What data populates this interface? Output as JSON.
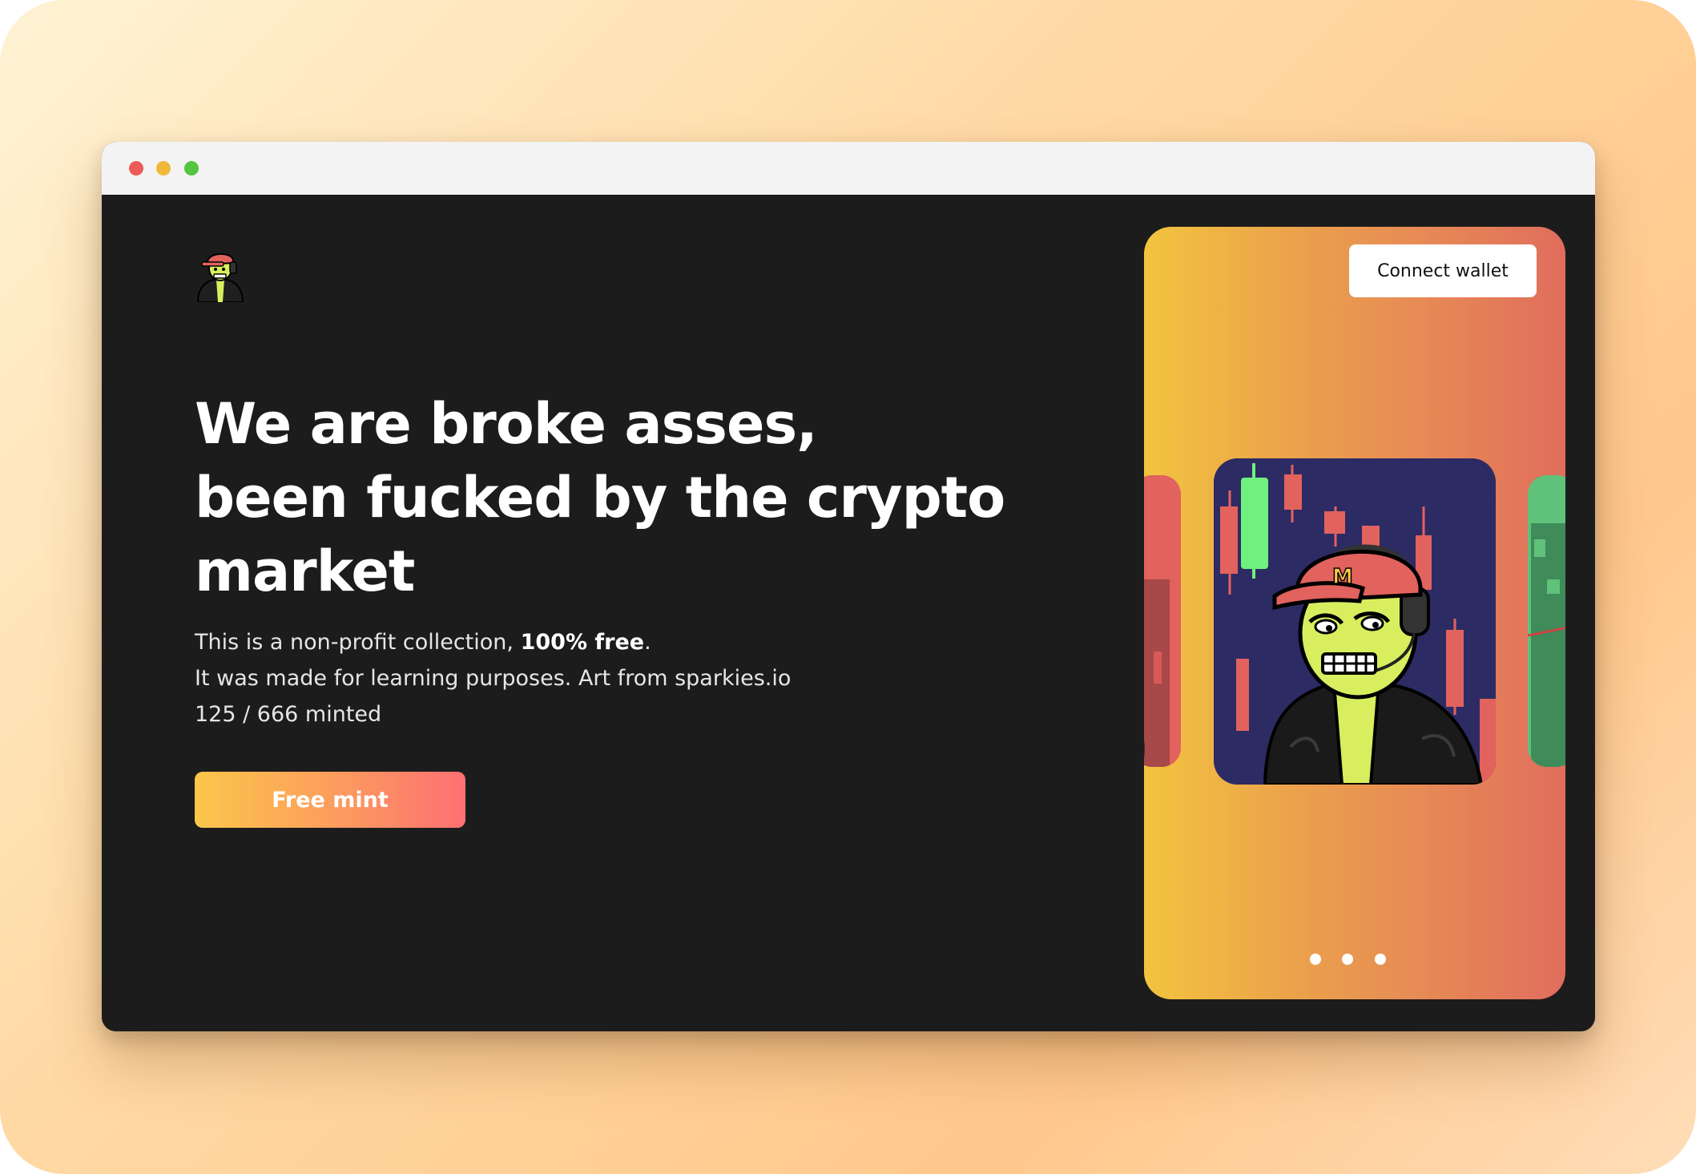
{
  "hero": {
    "headline_lines": [
      "We are broke asses,",
      "been fucked by the crypto",
      "market"
    ],
    "description_line1_prefix": "This is a non-profit collection, ",
    "description_line1_bold": "100% free",
    "description_line1_suffix": ".",
    "description_line2": "It was made for learning purposes. Art from sparkies.io",
    "minted_status": "125 / 666 minted",
    "minted_count": 125,
    "minted_total": 666,
    "mint_button_label": "Free mint"
  },
  "header": {
    "connect_wallet_label": "Connect wallet",
    "logo_icon": "character-avatar-icon"
  },
  "carousel": {
    "slide_count": 3,
    "active_slide": 2,
    "slides": [
      "red-card",
      "character-card",
      "green-card"
    ]
  },
  "colors": {
    "page_background": "#1c1c1c",
    "accent_start": "#fbc64a",
    "accent_end": "#fd6f73",
    "panel_start": "#f2c43e",
    "panel_end": "#e06d5d",
    "titlebar_red": "#ec5b57",
    "titlebar_yellow": "#f0b83a",
    "titlebar_green": "#55c43f"
  }
}
